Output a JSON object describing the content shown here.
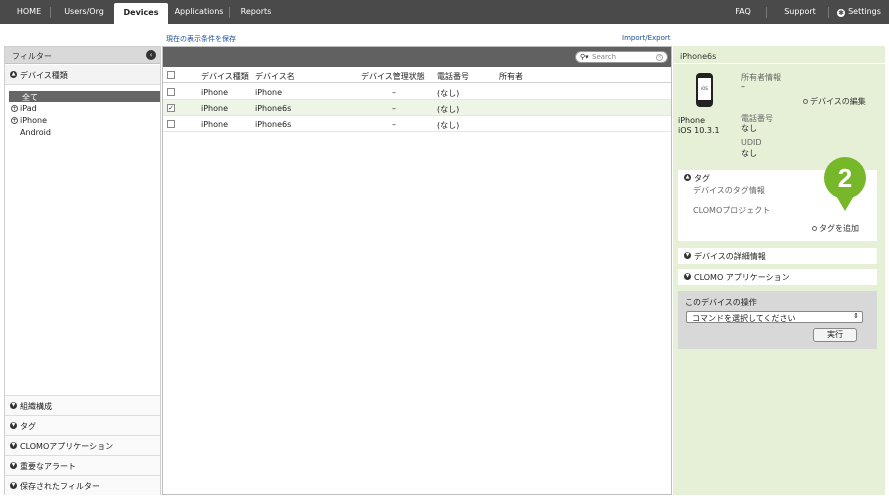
{
  "nav": {
    "tabs": [
      {
        "label": "HOME"
      },
      {
        "label": "Users/Org"
      },
      {
        "label": "Devices"
      },
      {
        "label": "Applications"
      },
      {
        "label": "Reports"
      }
    ],
    "active_tab": "Devices",
    "right": {
      "faq": "FAQ",
      "support": "Support",
      "settings": "Settings"
    }
  },
  "toplinks": {
    "save_filter": "現在の表示条件を保存",
    "import_export": "Import/Export"
  },
  "sidebar": {
    "header": "フィルター",
    "section": "デバイス種類",
    "all": "全て",
    "tree": [
      "iPad",
      "iPhone",
      "Android"
    ],
    "bottom": [
      "組織構成",
      "タグ",
      "CLOMOアプリケーション",
      "重要なアラート",
      "保存されたフィルター"
    ]
  },
  "search": {
    "placeholder": "Search"
  },
  "table": {
    "columns": [
      "デバイス種類",
      "デバイス名",
      "デバイス管理状態",
      "電話番号",
      "所有者"
    ],
    "rows": [
      {
        "type": "iPhone",
        "name": "iPhone",
        "status": "–",
        "phone": "(なし)",
        "owner": "",
        "checked": false
      },
      {
        "type": "iPhone",
        "name": "iPhone6s",
        "status": "–",
        "phone": "(なし)",
        "owner": "",
        "checked": true
      },
      {
        "type": "iPhone",
        "name": "iPhone6s",
        "status": "–",
        "phone": "(なし)",
        "owner": "",
        "checked": false
      }
    ]
  },
  "detail": {
    "title": "iPhone6s",
    "phone_screen": "iOS",
    "model": "iPhone",
    "os": "iOS 10.3.1",
    "owner_label": "所有者情報",
    "owner_value": "–",
    "edit_link": "デバイスの編集",
    "phone_label": "電話番号",
    "phone_value": "なし",
    "udid_label": "UDID",
    "udid_value": "なし",
    "tag_title": "タグ",
    "tag_info": "デバイスのタグ情報",
    "tag_project": "CLOMOプロジェクト",
    "add_tag": "タグを追加",
    "callout_number": "2",
    "detail_info": "デバイスの詳細情報",
    "clomo_app": "CLOMO アプリケーション",
    "operation_title": "このデバイスの操作",
    "command_select": "コマンドを選択してください",
    "exec_button": "実行"
  },
  "colors": {
    "nav_bg": "#4a4a4a",
    "right_panel_bg": "#e6f0d6",
    "callout_green": "#77b82a"
  }
}
